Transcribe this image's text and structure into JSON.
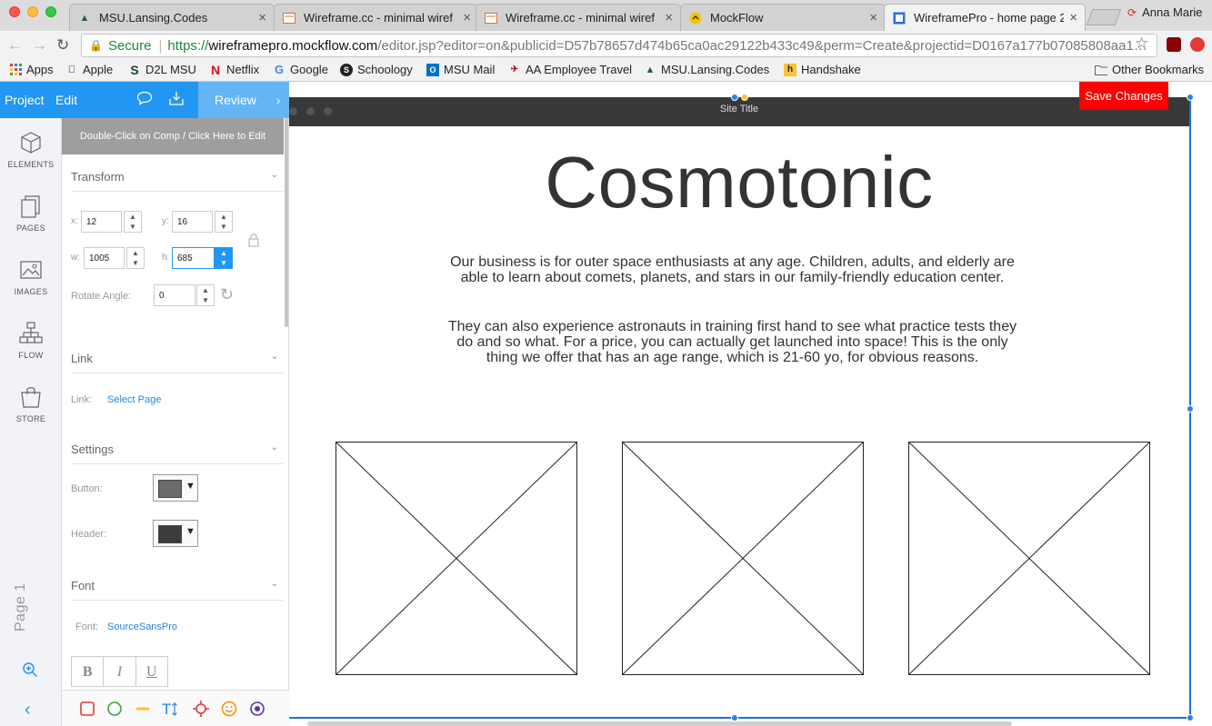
{
  "browser": {
    "tabs": [
      {
        "title": "MSU.Lansing.Codes"
      },
      {
        "title": "Wireframe.cc - minimal wiref"
      },
      {
        "title": "Wireframe.cc - minimal wiref"
      },
      {
        "title": "MockFlow"
      },
      {
        "title": "WireframePro - home page 2"
      }
    ],
    "profile_name": "Anna Marie",
    "address": {
      "secure_label": "Secure",
      "scheme": "https://",
      "host": "wireframepro.mockflow.com",
      "path": "/editor.jsp?editor=on&publicid=D57b78657d474b65ca0ac29122b433c49&perm=Create&projectid=D0167a177b07085808aa1…"
    },
    "bookmarks": [
      "Apps",
      "Apple",
      "D2L MSU",
      "Netflix",
      "Google",
      "Schoology",
      "MSU Mail",
      "AA Employee Travel",
      "MSU.Lansing.Codes",
      "Handshake"
    ],
    "other_bookmarks": "Other Bookmarks"
  },
  "app": {
    "menu": {
      "project": "Project",
      "edit": "Edit",
      "review": "Review"
    },
    "rail": [
      "ELEMENTS",
      "PAGES",
      "IMAGES",
      "FLOW",
      "STORE"
    ],
    "page_label": "Page 1",
    "panel": {
      "hint": "Double-Click on Comp / Click Here to Edit",
      "transform": {
        "title": "Transform",
        "x_label": "x:",
        "x": "12",
        "y_label": "y:",
        "y": "16",
        "w_label": "w:",
        "w": "1005",
        "h_label": "h:",
        "h": "685",
        "rotate_label": "Rotate Angle:",
        "rotate": "0"
      },
      "link": {
        "title": "Link",
        "label": "Link:",
        "value": "Select Page"
      },
      "settings": {
        "title": "Settings",
        "button_label": "Button:",
        "button_color": "#6b6b6b",
        "header_label": "Header:",
        "header_color": "#3c3c3c"
      },
      "font": {
        "title": "Font",
        "label": "Font:",
        "value": "SourceSansPro",
        "bold": "B",
        "italic": "I",
        "underline": "U"
      }
    }
  },
  "canvas": {
    "site_title": "Site Title",
    "save_button": "Save Changes",
    "heading": "Cosmotonic",
    "paragraph1_line1": "Our business is for outer space enthusiasts at any age. Children, adults, and elderly are",
    "paragraph1_line2": "able to learn about comets, planets, and stars in our family-friendly education center.",
    "paragraph2_line1": "They can also experience astronauts in training first hand to see what practice tests they",
    "paragraph2_line2": "do and so what. For a price, you can actually get launched into space! This is the only",
    "paragraph2_line3": "thing we offer that has an age range, which is 21-60 yo, for obvious reasons.",
    "colors": {
      "accent": "#2196f3",
      "save": "#ff0000",
      "header_bar": "#383838"
    }
  }
}
